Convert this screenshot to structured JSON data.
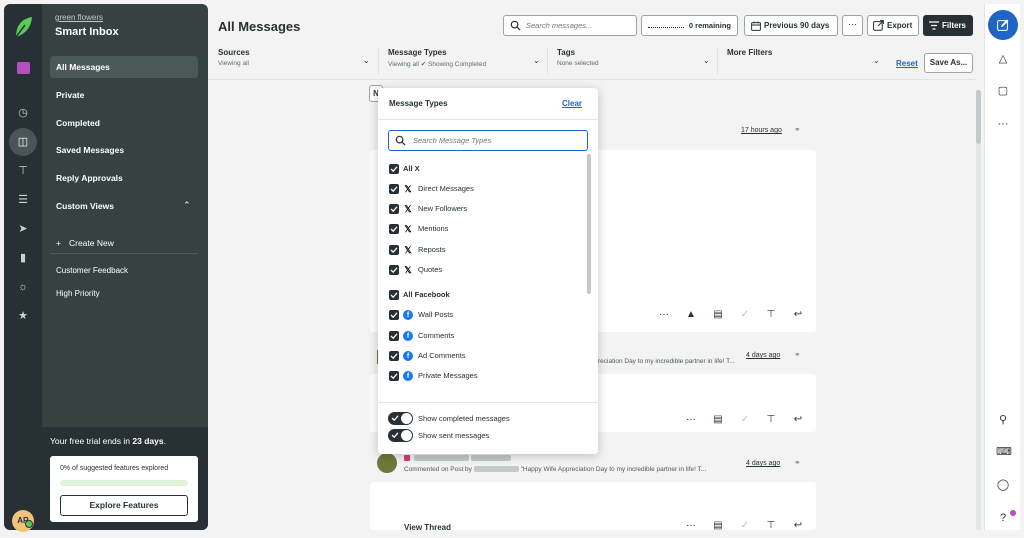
{
  "sidebar": {
    "brand_name": "green flowers",
    "app_title": "Smart Inbox",
    "items": [
      {
        "label": "All Messages"
      },
      {
        "label": "Private"
      },
      {
        "label": "Completed"
      },
      {
        "label": "Saved Messages"
      },
      {
        "label": "Reply Approvals"
      },
      {
        "label": "Custom Views"
      }
    ],
    "create_new": "Create New",
    "views": [
      "Customer Feedback",
      "High Priority"
    ],
    "trial_prefix": "Your free trial ends in",
    "trial_days": "23 days",
    "features_text": "0% of suggested features explored",
    "features_progress": 0.0,
    "explore_button": "Explore Features",
    "avatar_initials": "AR"
  },
  "header": {
    "title": "All Messages",
    "search_placeholder": "Search messages...",
    "remaining": "0 remaining",
    "period": "Previous 90 days",
    "more": "···",
    "export": "Export",
    "filters": "Filters"
  },
  "filter_bar": {
    "sources": {
      "title": "Sources",
      "sub": "Viewing all"
    },
    "message_types": {
      "title": "Message Types",
      "sub": "Viewing all ✔ Showing Completed"
    },
    "tags": {
      "title": "Tags",
      "sub": "None selected"
    },
    "more_filters": {
      "title": "More Filters"
    },
    "reset": "Reset",
    "save_as": "Save As...",
    "sort_letter": "N"
  },
  "stream": {
    "card1_time": "17 hours ago",
    "card2_time": "4 days ago",
    "card2_preview": "reciation Day to my incredible partner in life! T...",
    "card3_time": "4 days ago",
    "card3_preview_prefix": "Commented on Post by",
    "card3_preview": "\"Happy Wife Appreciation Day to my incredible partner in life! T...",
    "view_thread": "View Thread"
  },
  "dropdown": {
    "title": "Message Types",
    "clear": "Clear",
    "search_placeholder": "Search Message Types",
    "groups": [
      {
        "label": "All X",
        "network": "x-icon",
        "items": [
          "Direct Messages",
          "New Followers",
          "Mentions",
          "Reposts",
          "Quotes"
        ]
      },
      {
        "label": "All Facebook",
        "network": "facebook-icon",
        "items": [
          "Wall Posts",
          "Comments",
          "Ad Comments",
          "Private Messages"
        ]
      }
    ],
    "toggles": [
      "Show completed messages",
      "Show sent messages"
    ]
  },
  "colors": {
    "rail": "#273135",
    "sidebar": "#364141",
    "accent_blue": "#2064c8",
    "facebook": "#1877f2",
    "brand_green": "#59cb59"
  }
}
